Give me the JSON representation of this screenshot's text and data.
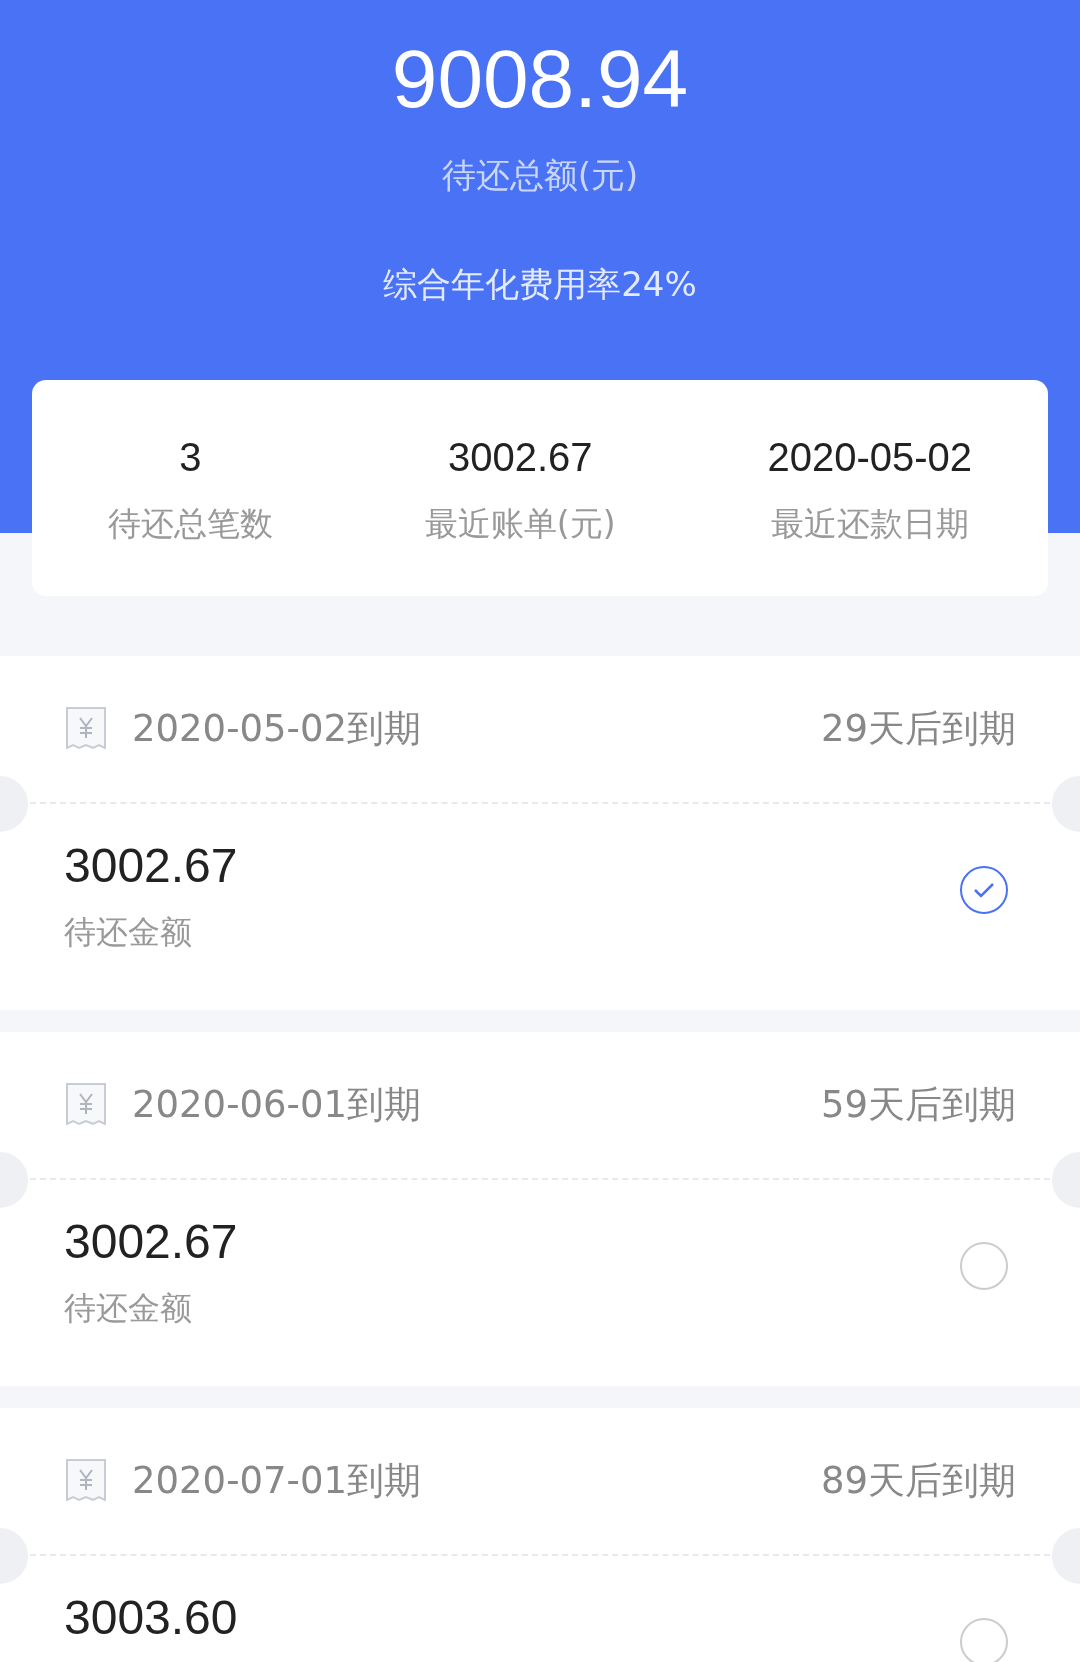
{
  "summary": {
    "total": "9008.94",
    "total_label": "待还总额(元)",
    "rate": "综合年化费用率24%"
  },
  "stats": [
    {
      "value": "3",
      "label": "待还总笔数"
    },
    {
      "value": "3002.67",
      "label": "最近账单(元)"
    },
    {
      "value": "2020-05-02",
      "label": "最近还款日期"
    }
  ],
  "bills": [
    {
      "due": "2020-05-02到期",
      "countdown": "29天后到期",
      "amount": "3002.67",
      "amount_label": "待还金额",
      "selected": true
    },
    {
      "due": "2020-06-01到期",
      "countdown": "59天后到期",
      "amount": "3002.67",
      "amount_label": "待还金额",
      "selected": false
    },
    {
      "due": "2020-07-01到期",
      "countdown": "89天后到期",
      "amount": "3003.60",
      "selected": false
    }
  ]
}
